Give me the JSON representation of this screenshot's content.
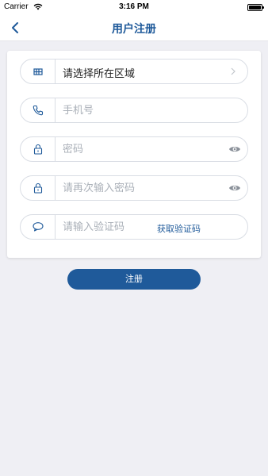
{
  "status_bar": {
    "carrier": "Carrier",
    "time": "3:16 PM"
  },
  "nav": {
    "title": "用户注册"
  },
  "form": {
    "region": {
      "label": "请选择所在区域",
      "icon": "region-icon"
    },
    "phone": {
      "placeholder": "手机号",
      "icon": "phone-icon"
    },
    "password": {
      "placeholder": "密码",
      "icon": "lock-icon"
    },
    "confirm_password": {
      "placeholder": "请再次输入密码",
      "icon": "lock-icon"
    },
    "code": {
      "placeholder": "请输入验证码",
      "icon": "message-icon",
      "link": "获取验证码"
    }
  },
  "register": {
    "label": "注册"
  },
  "colors": {
    "accent": "#1f5a9a",
    "background": "#efeff4",
    "placeholder": "#aab0b8"
  }
}
